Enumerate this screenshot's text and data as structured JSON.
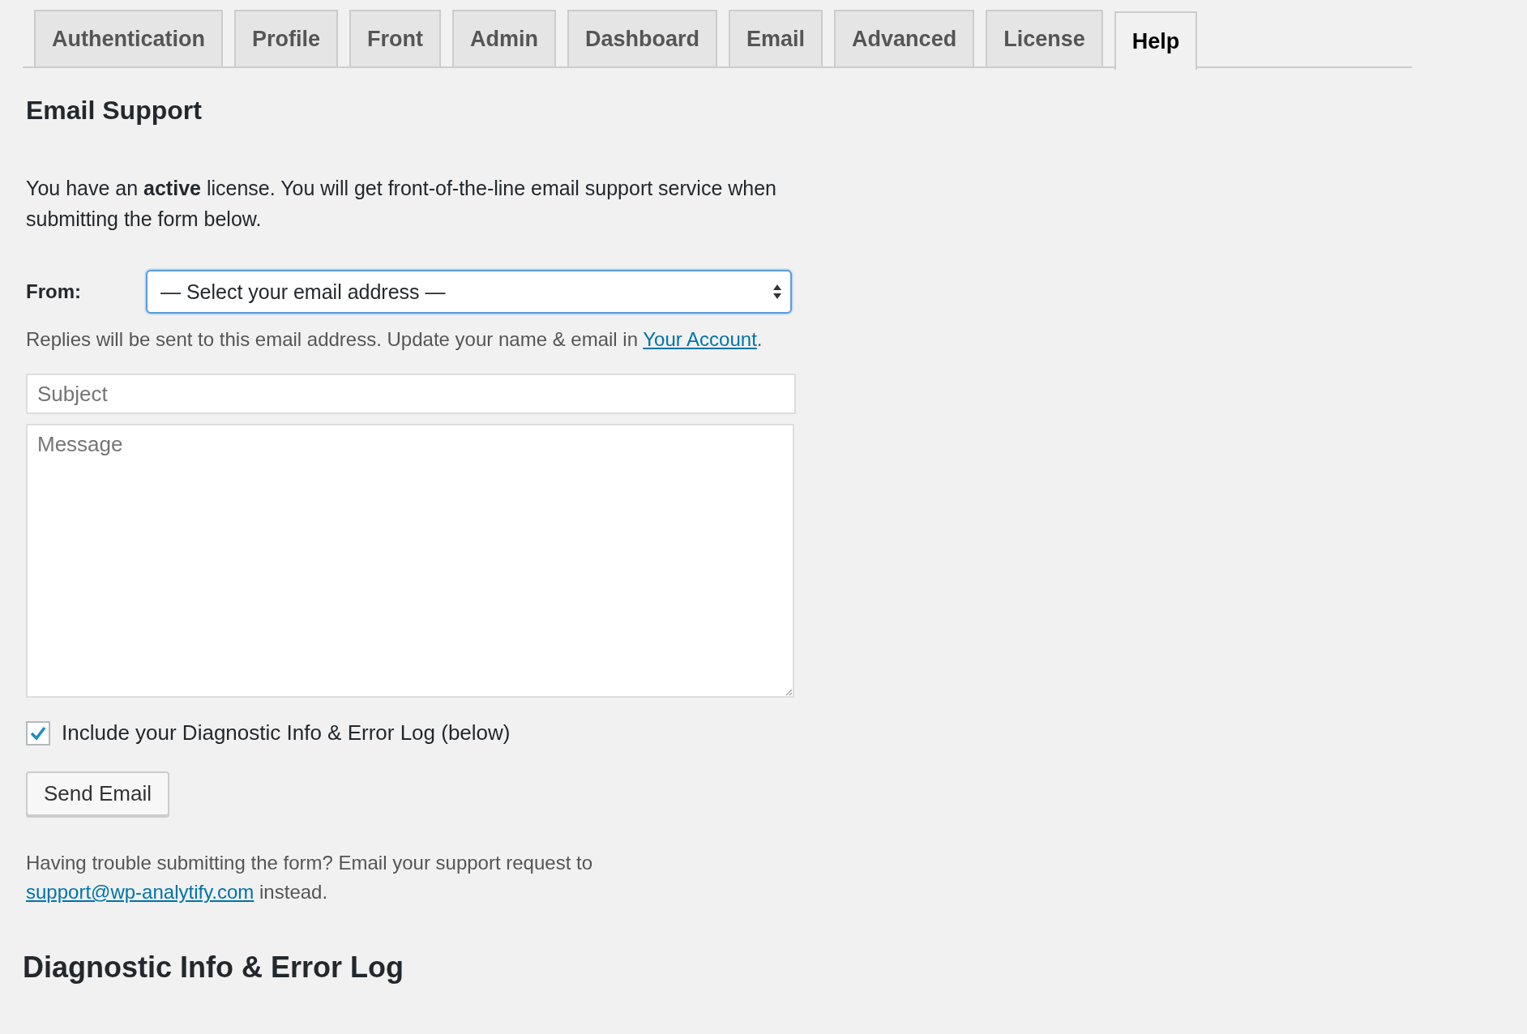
{
  "tabs": [
    {
      "label": "Authentication",
      "selected": false
    },
    {
      "label": "Profile",
      "selected": false
    },
    {
      "label": "Front",
      "selected": false
    },
    {
      "label": "Admin",
      "selected": false
    },
    {
      "label": "Dashboard",
      "selected": false
    },
    {
      "label": "Email",
      "selected": false
    },
    {
      "label": "Advanced",
      "selected": false
    },
    {
      "label": "License",
      "selected": false
    },
    {
      "label": "Help",
      "selected": true
    }
  ],
  "email_support": {
    "title": "Email Support",
    "intro": "You have an **active** license. You will get front-of-the-line email support service when submitting the form below.",
    "from_label": "From:",
    "from_select": "— Select your email address —",
    "from_hint": "Replies will be sent to this email address. Update your name & email in ",
    "from_hint_link": "Your Account",
    "from_hint_end": ".",
    "subject": {
      "placeholder": "Subject"
    },
    "message": {
      "placeholder": "Message"
    },
    "include_diagnostics": {
      "label": "Include your Diagnostic Info & Error Log (below)",
      "checked": true
    },
    "send_button": "Send Email",
    "trouble_text": "Having trouble submitting the form? Email your support request to ",
    "trouble_link": "support@wp-analytify.com",
    "trouble_end": " instead."
  },
  "diagnostic": {
    "title": "Diagnostic Info & Error Log"
  }
}
